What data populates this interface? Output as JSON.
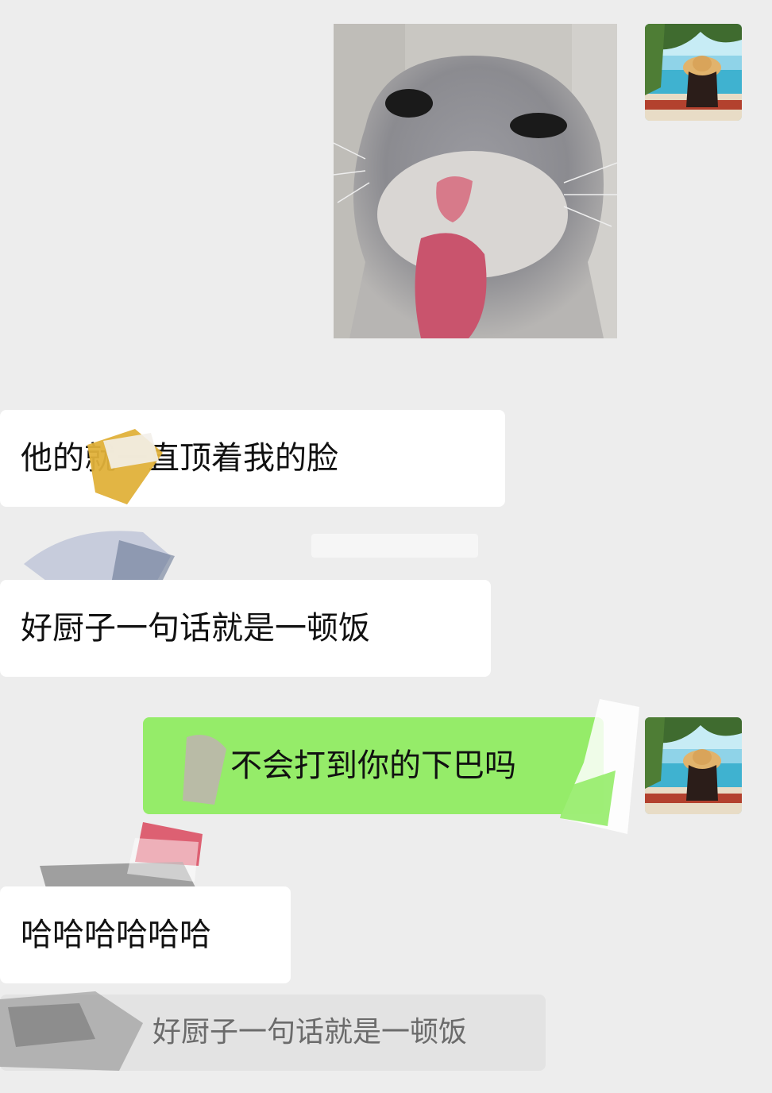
{
  "chat": {
    "messages": [
      {
        "id": "m1",
        "side": "sent",
        "type": "image",
        "sticker": "cat-tongue"
      },
      {
        "id": "m2",
        "side": "received",
        "text": "他的就一直顶着我的脸"
      },
      {
        "id": "m3",
        "side": "received",
        "text": "好厨子一句话就是一顿饭"
      },
      {
        "id": "m4",
        "side": "sent",
        "text": "不会打到你的下巴吗"
      },
      {
        "id": "m5",
        "side": "received",
        "text": "哈哈哈哈哈哈"
      }
    ],
    "quote": {
      "text": "好厨子一句话就是一顿饭"
    }
  },
  "icons": {
    "avatar": "avatar-straw-hat-beach-icon",
    "sticker": "cat-sticker-icon"
  },
  "colors": {
    "background": "#ededed",
    "sent_bubble": "#95ec69",
    "received_bubble": "#ffffff",
    "quote_bubble": "#e3e3e3"
  }
}
